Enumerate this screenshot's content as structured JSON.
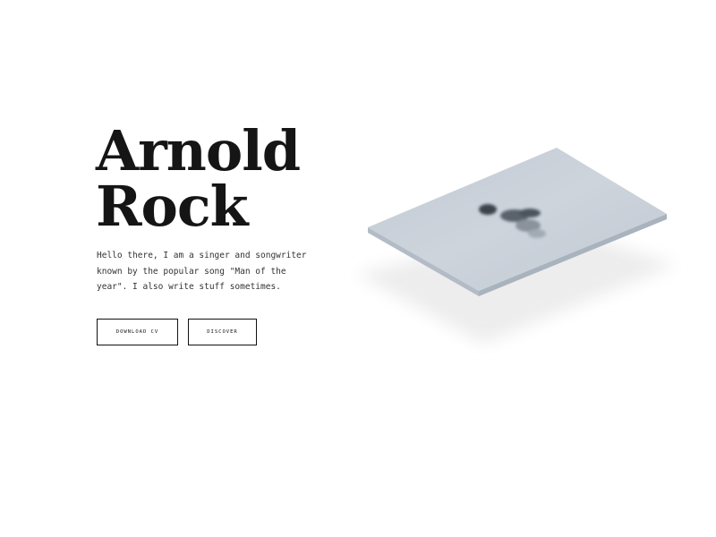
{
  "hero": {
    "title_line1": "Arnold",
    "title_line2": "Rock",
    "description": "Hello there, I am a singer and songwriter known by the popular song \"Man of the year\". I also write stuff sometimes."
  },
  "buttons": {
    "download_label": "DOWNLOAD CV",
    "discover_label": "DISCOVER"
  },
  "colors": {
    "text": "#151515",
    "photo": "#c8d0d8",
    "shadow": "#eeeeee"
  }
}
